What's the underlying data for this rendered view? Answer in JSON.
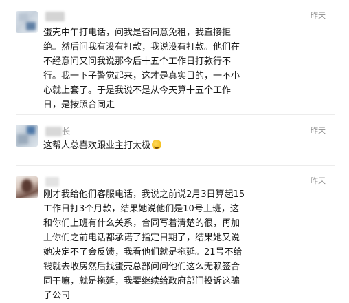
{
  "comments": [
    {
      "time": "昨天",
      "lines": [
        "蛋壳中午打电话，问我是否同意免租，我直接拒",
        "绝。然后问我有没有打款，我说没有打款。他们在",
        "不经意间又问我说那今后十五个工作日打款行不",
        "行。我一下子警觉起来，这才是真实目的，一不小",
        "心就上套了。于是我说不是从今天算十五个工作",
        "日，是按照合同走"
      ]
    },
    {
      "time": "昨天",
      "name_fragment": "长",
      "text": "这帮人总喜欢跟业主打太极",
      "emoji": "facepalm-emoji"
    },
    {
      "time": "昨天",
      "lines": [
        "刚才我给他们客服电话，我说之前说2月3日算起15",
        "工作日打3个月款，结果她说他们是10号上班，这",
        "和你们上班有什么关系，合同写着清楚的很，再加",
        "上你们之前电话都承诺了指定日期了，结果她又说",
        "她决定不了会反馈，我看他们就是拖延。21号不给",
        "钱就去收房然后找蛋壳总部问问他们这么无赖签合",
        "同干嘛，就是拖延，我要继续给政府部门投诉这骗",
        "子公司"
      ]
    }
  ]
}
